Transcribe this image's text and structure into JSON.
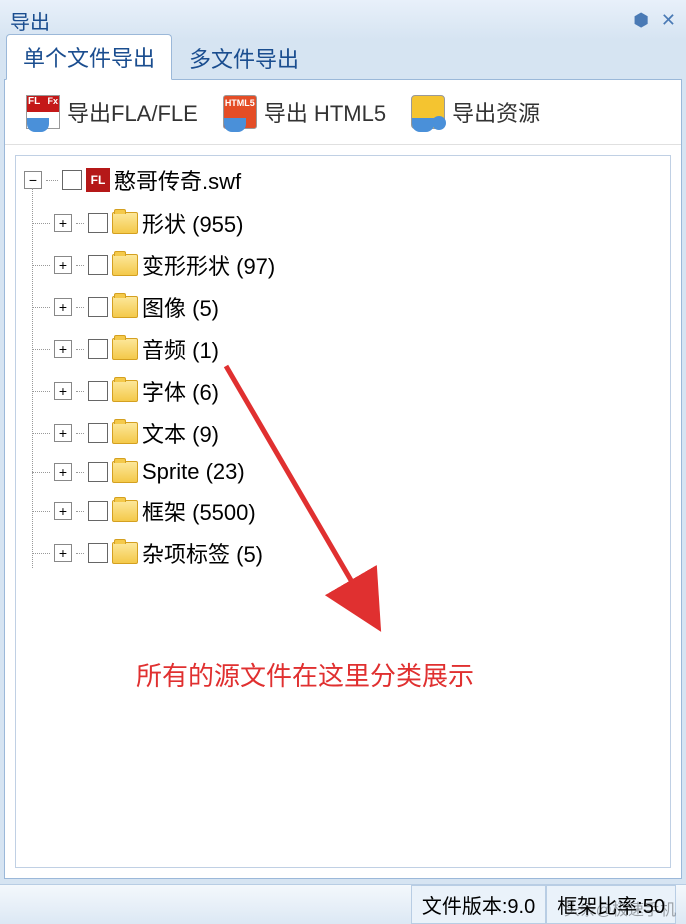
{
  "window": {
    "title": "导出"
  },
  "tabs": {
    "single": "单个文件导出",
    "multi": "多文件导出"
  },
  "toolbar": {
    "fla_label": "导出FLA/FLE",
    "html5_label": "导出 HTML5",
    "resource_label": "导出资源",
    "html5_badge": "HTML5"
  },
  "tree": {
    "root": "憨哥传奇.swf",
    "items": [
      {
        "label": "形状 (955)"
      },
      {
        "label": "变形形状 (97)"
      },
      {
        "label": "图像 (5)"
      },
      {
        "label": "音频 (1)"
      },
      {
        "label": "字体 (6)"
      },
      {
        "label": "文本 (9)"
      },
      {
        "label": "Sprite (23)"
      },
      {
        "label": "框架 (5500)"
      },
      {
        "label": "杂项标签 (5)"
      }
    ]
  },
  "annotation": {
    "text": "所有的源文件在这里分类展示"
  },
  "statusbar": {
    "version": "文件版本:9.0",
    "frame_ratio": "框架比率:50"
  },
  "watermark": "头条@极速手机"
}
